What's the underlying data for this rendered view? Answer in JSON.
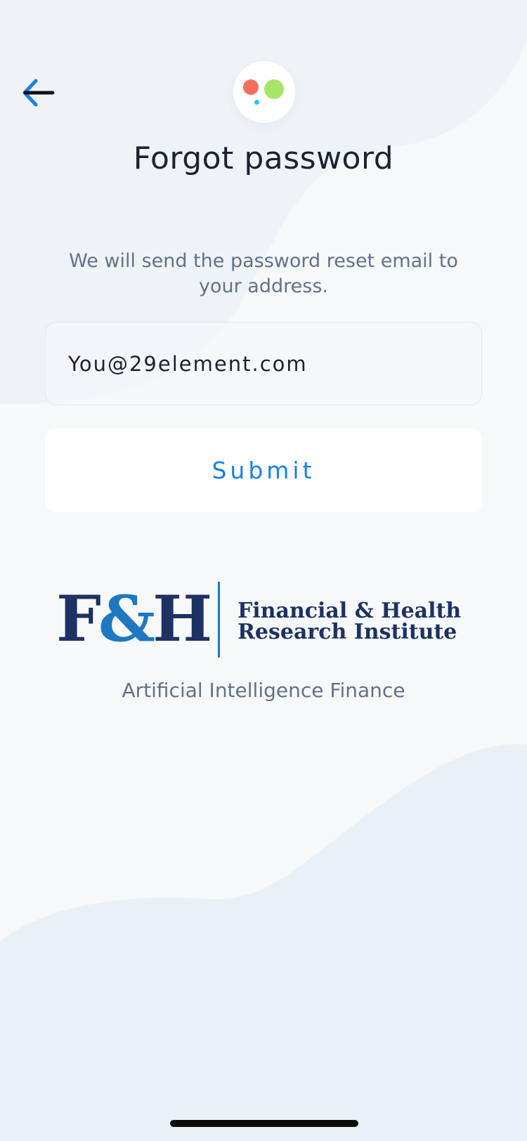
{
  "header": {
    "back_icon": "arrow-left-icon",
    "app_logo_icon": "colored-dots-icon",
    "title": "Forgot password"
  },
  "form": {
    "instructions": "We will send the password reset email to your address.",
    "email_value": "You@29element.com",
    "submit_label": "Submit"
  },
  "partner": {
    "logo_mark": "F&H",
    "name_line_1": "Financial & Health",
    "name_line_2": "Research Institute",
    "tagline": "Artificial Intelligence Finance"
  },
  "colors": {
    "accent": "#1780e8",
    "background": "#f6f8fa",
    "title": "#1b2231",
    "secondary_text": "#63718a",
    "logo_dot_red": "#f76e5e",
    "logo_dot_green": "#a9e46a",
    "logo_dot_cyan": "#20c8ee",
    "partner_navy": "#1d3263",
    "partner_blue": "#1e78c2"
  }
}
